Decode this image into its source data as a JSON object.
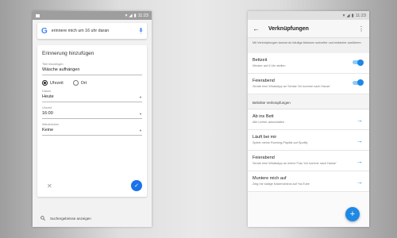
{
  "left": {
    "status_time": "11:23",
    "search": {
      "query": "erinnere mich um 16 uhr daran"
    },
    "form": {
      "title": "Erinnerung hinzufügen",
      "what_label": "Titel hinzufügen",
      "what_value": "Wäsche aufhängen",
      "radio_time": "Uhrzeit",
      "radio_place": "Ort",
      "date_label": "Datum",
      "date_value": "Heute",
      "time_label": "Uhrzeit",
      "time_value": "16:00",
      "repeat_label": "Wiederholen",
      "repeat_value": "Keine"
    },
    "bottom_search": "Suchergebnisse anzeigen"
  },
  "right": {
    "status_time": "11:23",
    "title": "Verknüpfungen",
    "intro": "Mit Verknüpfungen kannst du häufige Aktionen schneller und einfacher ausführen",
    "active": [
      {
        "title": "Bettzeit",
        "sub": "Wecker auf 6 Uhr stellen"
      },
      {
        "title": "Feierabend",
        "sub": "Sende eine WhatsApp an Schatz 'Ich komme nach Hause'"
      }
    ],
    "section_title": "Beliebte Verknüpfungen",
    "popular": [
      {
        "title": "Ab ins Bett",
        "sub": "Alle Lichter ausschalten"
      },
      {
        "title": "Läuft bei mir",
        "sub": "Spiele meine Running-Playlist auf Spotify"
      },
      {
        "title": "Feierabend",
        "sub": "Sende eine WhatsApp an meine Frau 'Ich komme nach Hause'"
      },
      {
        "title": "Muntere mich auf",
        "sub": "Zeig mir lustige Katzenvideos auf YouTube"
      }
    ]
  },
  "icons": {
    "back": "arrow-left-icon",
    "overflow": "more-vert-icon",
    "row_arrow": "arrow-right-icon",
    "fab": "plus-icon",
    "confirm": "check-icon",
    "cancel": "close-icon"
  },
  "colors": {
    "accent": "#1e88e5"
  }
}
